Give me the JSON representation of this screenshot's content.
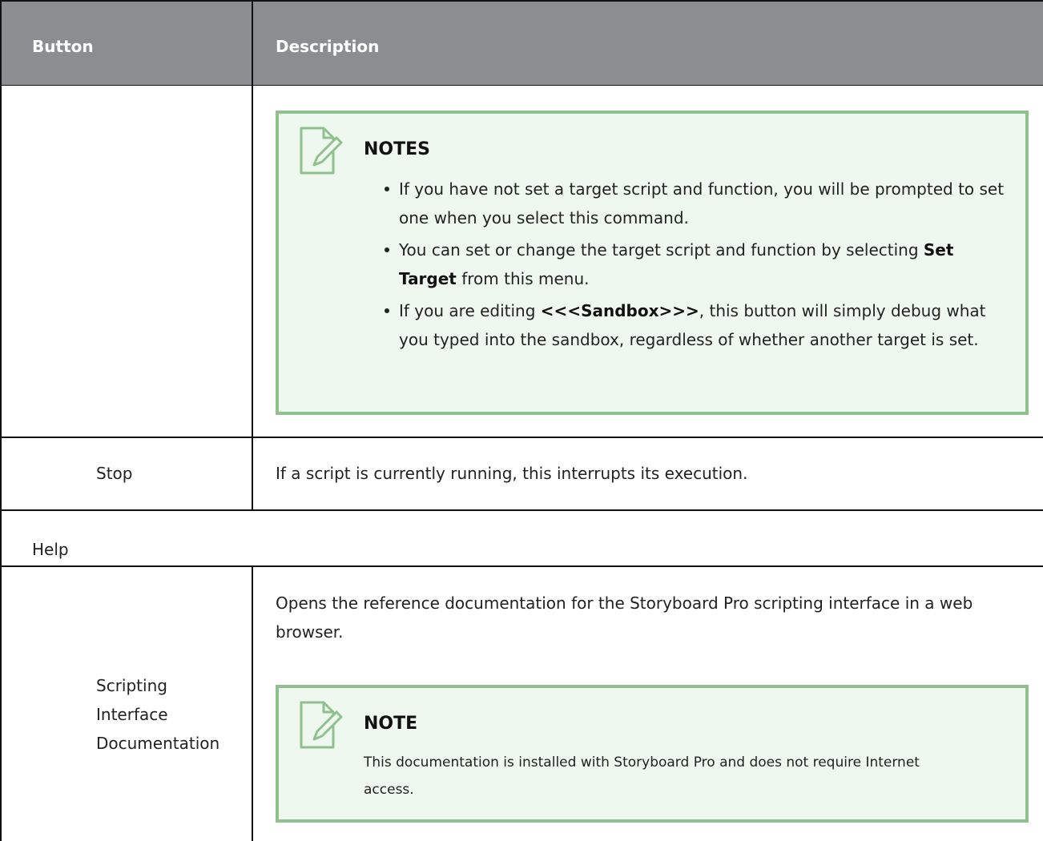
{
  "table": {
    "headers": {
      "button": "Button",
      "description": "Description"
    },
    "rows": {
      "debug_notes": {
        "title": "NOTES",
        "bullets": [
          {
            "text": "If you have not set a target script and function, you will be prompted to set one when you select this command."
          },
          {
            "pre": "You can set or change the target script and function by selecting ",
            "bold": "Set Target",
            "post": " from this menu."
          },
          {
            "pre": "If you are editing ",
            "bold": "<<<Sandbox>>>",
            "post": ", this button will simply debug what you typed into the sandbox, regardless of whether another target is set."
          }
        ]
      },
      "stop": {
        "button": "Stop",
        "description": "If a script is currently running, this interrupts its execution."
      },
      "help_section": {
        "label": "Help"
      },
      "scripting_docs": {
        "button": "Scripting Interface Documentation",
        "description": "Opens the reference documentation for the Storyboard Pro scripting interface in a web browser.",
        "note_title": "NOTE",
        "note_text": "This documentation is installed with Storyboard Pro and does not require Internet access."
      }
    }
  },
  "icons": {
    "note": "note-pencil-icon"
  },
  "colors": {
    "header_bg": "#8c8d8f",
    "note_bg": "#eff8ee",
    "note_border": "#8fc08d"
  }
}
